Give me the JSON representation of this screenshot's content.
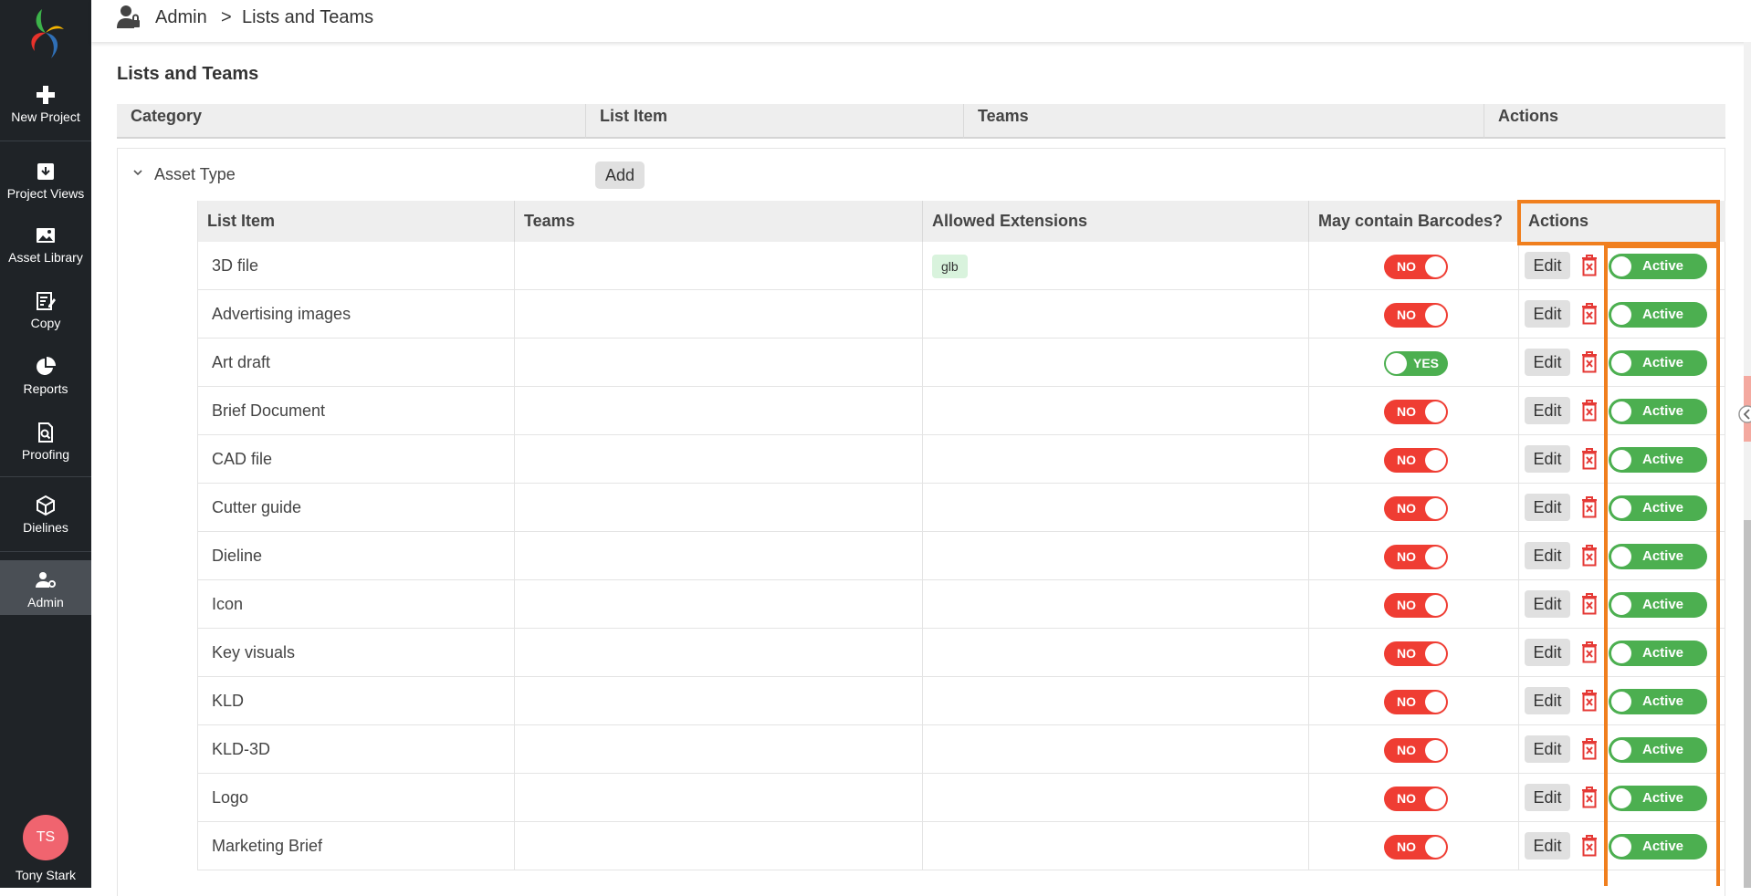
{
  "sidebar": {
    "items": [
      {
        "label": "New Project",
        "icon": "plus-icon"
      },
      {
        "label": "Project Views",
        "icon": "download-box-icon"
      },
      {
        "label": "Asset Library",
        "icon": "image-icon"
      },
      {
        "label": "Copy",
        "icon": "edit-document-icon"
      },
      {
        "label": "Reports",
        "icon": "pie-chart-icon"
      },
      {
        "label": "Proofing",
        "icon": "search-document-icon"
      },
      {
        "label": "Dielines",
        "icon": "box-icon"
      },
      {
        "label": "Admin",
        "icon": "user-gear-icon",
        "active": true
      }
    ],
    "user": {
      "initials": "TS",
      "name": "Tony Stark"
    }
  },
  "breadcrumb": {
    "root": "Admin",
    "separator": ">",
    "current": "Lists and Teams"
  },
  "page_title": "Lists and Teams",
  "category_table": {
    "headers": [
      "Category",
      "List Item",
      "Teams",
      "Actions"
    ]
  },
  "group": {
    "name": "Asset Type",
    "add_label": "Add",
    "headers": [
      "List Item",
      "Teams",
      "Allowed Extensions",
      "May contain Barcodes?",
      "Actions"
    ],
    "edit_label": "Edit",
    "active_label": "Active",
    "rows": [
      {
        "name": "3D file",
        "ext": "glb",
        "barcode": "NO"
      },
      {
        "name": "Advertising images",
        "ext": "",
        "barcode": "NO"
      },
      {
        "name": "Art draft",
        "ext": "",
        "barcode": "YES"
      },
      {
        "name": "Brief Document",
        "ext": "",
        "barcode": "NO"
      },
      {
        "name": "CAD file",
        "ext": "",
        "barcode": "NO"
      },
      {
        "name": "Cutter guide",
        "ext": "",
        "barcode": "NO"
      },
      {
        "name": "Dieline",
        "ext": "",
        "barcode": "NO"
      },
      {
        "name": "Icon",
        "ext": "",
        "barcode": "NO"
      },
      {
        "name": "Key visuals",
        "ext": "",
        "barcode": "NO"
      },
      {
        "name": "KLD",
        "ext": "",
        "barcode": "NO"
      },
      {
        "name": "KLD-3D",
        "ext": "",
        "barcode": "NO"
      },
      {
        "name": "Logo",
        "ext": "",
        "barcode": "NO"
      },
      {
        "name": "Marketing Brief",
        "ext": "",
        "barcode": "NO"
      }
    ]
  },
  "colors": {
    "sidebar_bg": "#1f2327",
    "toggle_no": "#ef3d33",
    "toggle_yes": "#4caf50",
    "highlight": "#f07f1e",
    "avatar": "#f0646f"
  }
}
